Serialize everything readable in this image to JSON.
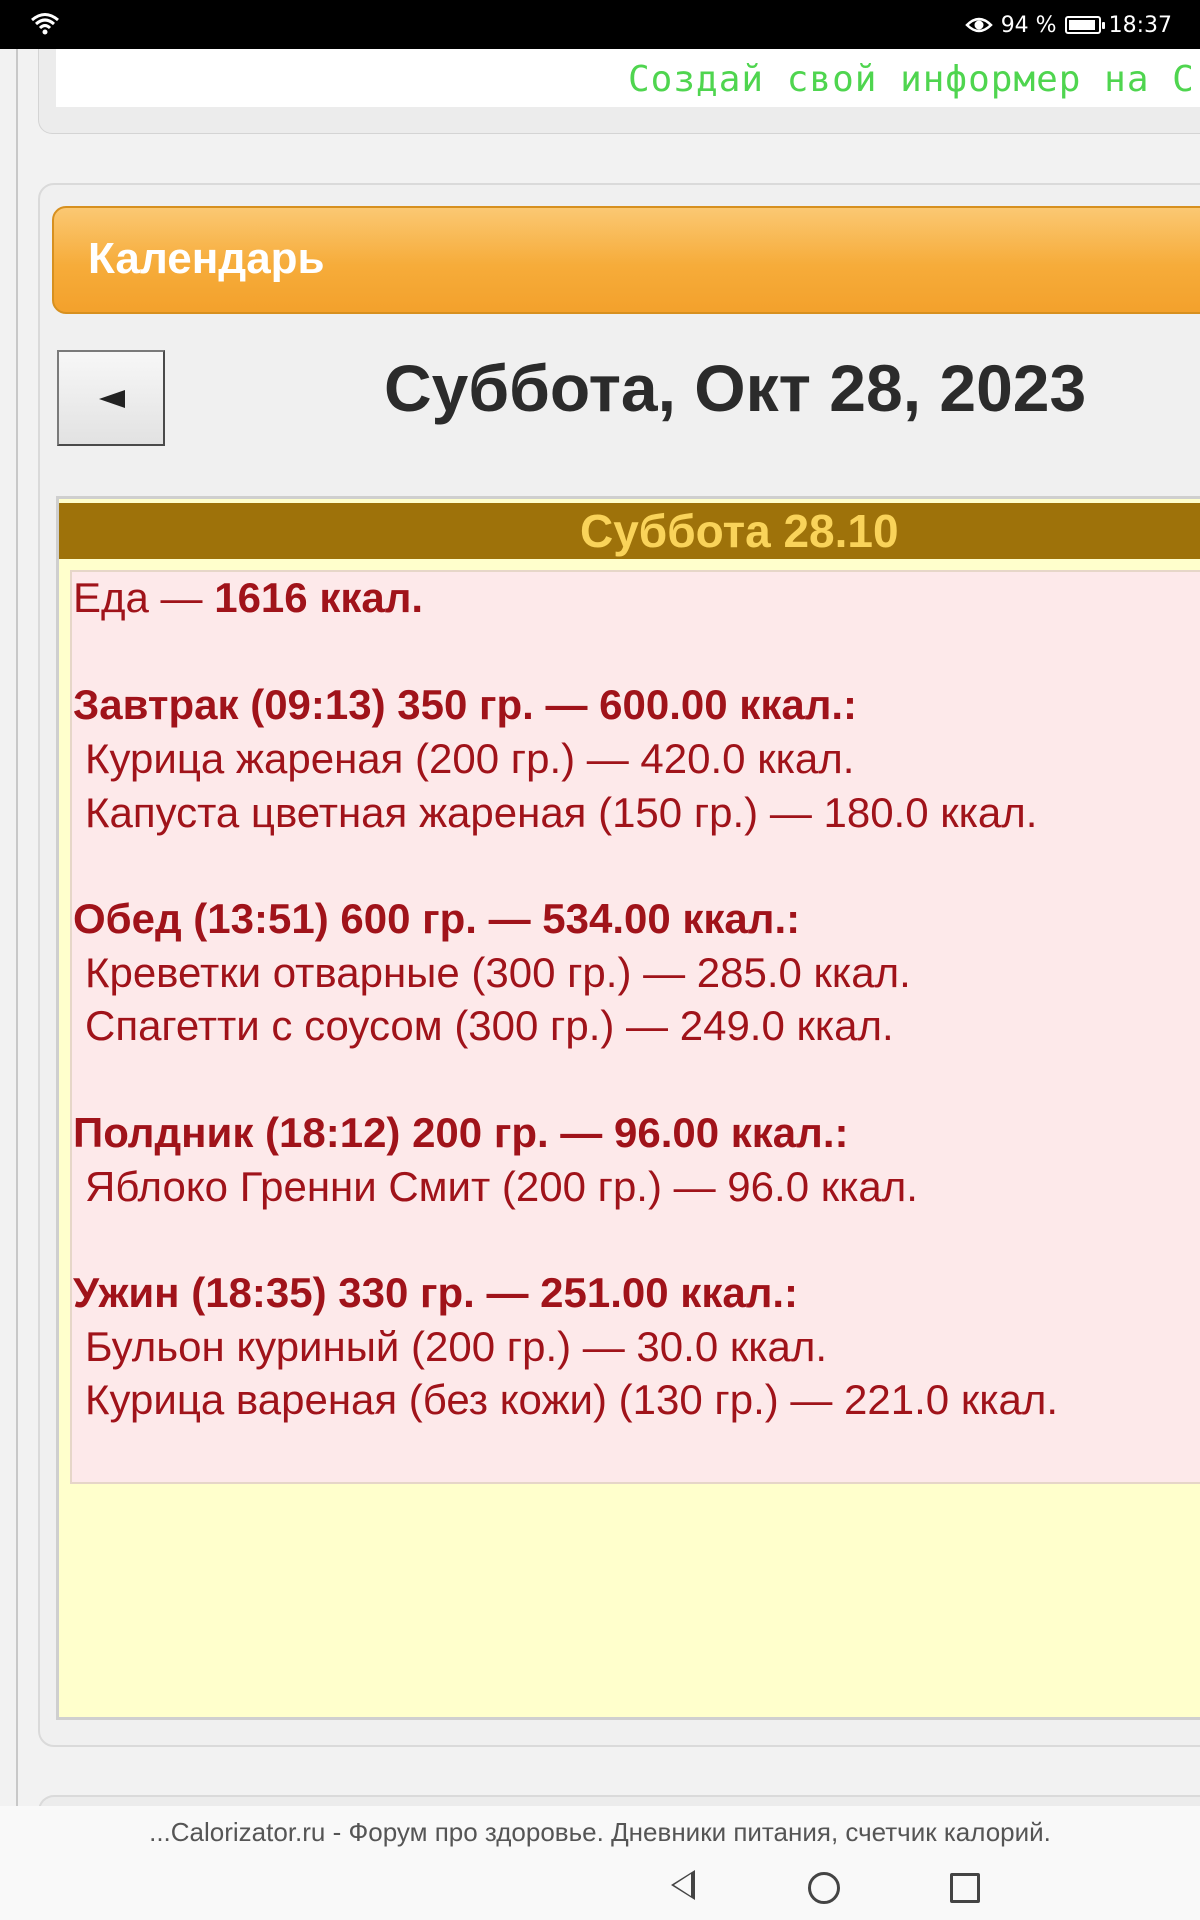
{
  "status_bar": {
    "battery_percent": "94 %",
    "battery_level": 0.94,
    "time": "18:37",
    "icons": [
      "wifi-icon",
      "eye-comfort-icon",
      "battery-icon"
    ]
  },
  "informer": {
    "text": "Создай свой информер на С"
  },
  "calendar": {
    "title": "Календарь",
    "prev_label": "◄",
    "date_heading": "Суббота, Окт 28, 2023",
    "day_title": "Суббота 28.10",
    "food_label": "Еда — ",
    "food_total": "1616 ккал.",
    "meals": [
      {
        "header": "Завтрак (09:13) 350 гр. — 600.00 ккал.:",
        "items": [
          "Курица жареная (200 гр.) — 420.0 ккал.",
          "Капуста цветная жареная (150 гр.) — 180.0 ккал."
        ]
      },
      {
        "header": "Обед (13:51) 600 гр. — 534.00 ккал.:",
        "items": [
          "Креветки отварные (300 гр.) — 285.0 ккал.",
          "Спагетти с соусом (300 гр.) — 249.0 ккал."
        ]
      },
      {
        "header": "Полдник (18:12) 200 гр. — 96.00 ккал.:",
        "items": [
          "Яблоко Гренни Смит (200 гр.) — 96.0 ккал."
        ]
      },
      {
        "header": "Ужин (18:35) 330 гр. — 251.00 ккал.:",
        "items": [
          "Бульон куриный (200 гр.) — 30.0 ккал.",
          "Курица вареная (без кожи) (130 гр.) — 221.0 ккал."
        ]
      }
    ]
  },
  "browser": {
    "page_title": "...Calorizator.ru - Форум про здоровье. Дневники питания, счетчик калорий."
  },
  "colors": {
    "accent_orange": "#f6ac3a",
    "day_bar": "#9e720a",
    "entry_text": "#a0131a",
    "informer_green": "#4fd54f"
  }
}
